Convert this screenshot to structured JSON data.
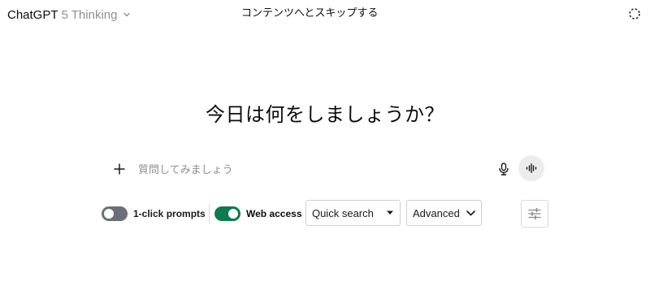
{
  "header": {
    "model_name": "ChatGPT",
    "model_version": "5 Thinking",
    "skip_link": "コンテンツへとスキップする"
  },
  "main": {
    "headline": "今日は何をしましょうか？"
  },
  "composer": {
    "placeholder": "質問してみましょう"
  },
  "toolbar": {
    "prompts_toggle": {
      "label": "1-click prompts",
      "on": false
    },
    "web_toggle": {
      "label": "Web access",
      "on": true
    },
    "search_mode": {
      "selected": "Quick search"
    },
    "advanced": {
      "label": "Advanced"
    }
  },
  "colors": {
    "toggle_on": "#10794f",
    "toggle_off": "#6b6f78",
    "voice_bg": "#ececec"
  },
  "icons": [
    "chevron-down-icon",
    "temporary-chat-icon",
    "plus-icon",
    "microphone-icon",
    "voice-waveform-icon",
    "caret-down-icon",
    "sliders-icon"
  ]
}
